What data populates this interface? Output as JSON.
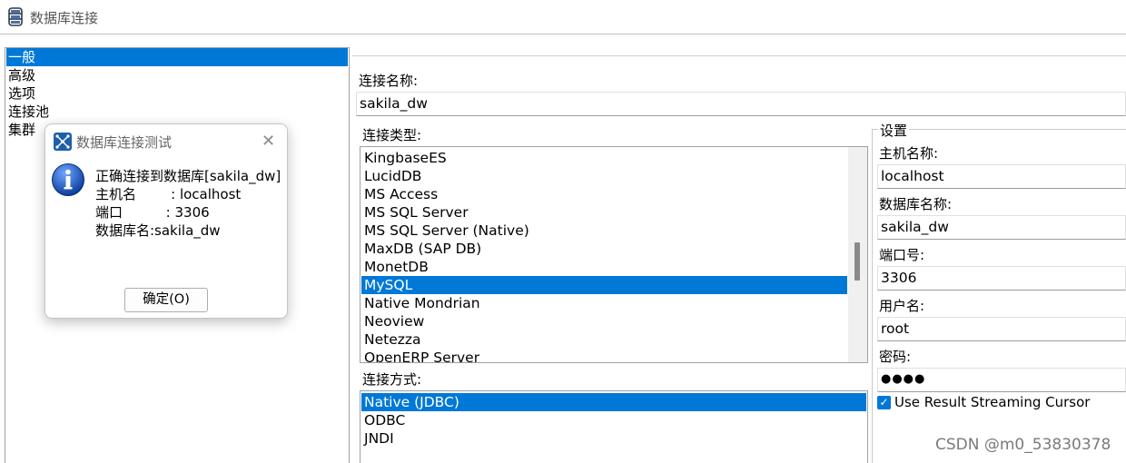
{
  "window": {
    "title": "数据库连接",
    "icon": "database-icon"
  },
  "nav": {
    "items": [
      {
        "label": "一般",
        "selected": true
      },
      {
        "label": "高级"
      },
      {
        "label": "选项"
      },
      {
        "label": "连接池"
      },
      {
        "label": "集群"
      }
    ]
  },
  "general": {
    "name_label": "连接名称:",
    "name_value": "sakila_dw",
    "type_label": "连接类型:",
    "types": [
      {
        "label": "KingbaseES"
      },
      {
        "label": "LucidDB"
      },
      {
        "label": "MS Access"
      },
      {
        "label": "MS SQL Server"
      },
      {
        "label": "MS SQL Server (Native)"
      },
      {
        "label": "MaxDB (SAP DB)"
      },
      {
        "label": "MonetDB"
      },
      {
        "label": "MySQL",
        "selected": true
      },
      {
        "label": "Native Mondrian"
      },
      {
        "label": "Neoview"
      },
      {
        "label": "Netezza"
      },
      {
        "label": "OpenERP Server"
      }
    ],
    "access_label": "连接方式:",
    "access_methods": [
      {
        "label": "Native (JDBC)",
        "selected": true
      },
      {
        "label": "ODBC"
      },
      {
        "label": "JNDI"
      }
    ]
  },
  "settings": {
    "group_label": "设置",
    "host_label": "主机名称:",
    "host_value": "localhost",
    "db_label": "数据库名称:",
    "db_value": "sakila_dw",
    "port_label": "端口号:",
    "port_value": "3306",
    "user_label": "用户名:",
    "user_value": "root",
    "password_label": "密码:",
    "password_value": "●●●●",
    "streaming_label": "Use Result Streaming Cursor",
    "streaming_checked": true
  },
  "dialog": {
    "title": "数据库连接测试",
    "icon": "info-icon",
    "lines": [
      "正确连接到数据库[sakila_dw]",
      "主机名        : localhost",
      "端口          : 3306",
      "数据库名:sakila_dw"
    ],
    "ok_label": "确定(O)"
  },
  "watermark": "CSDN @m0_53830378",
  "colors": {
    "selection": "#0078d7",
    "border": "#a0a0a0"
  }
}
